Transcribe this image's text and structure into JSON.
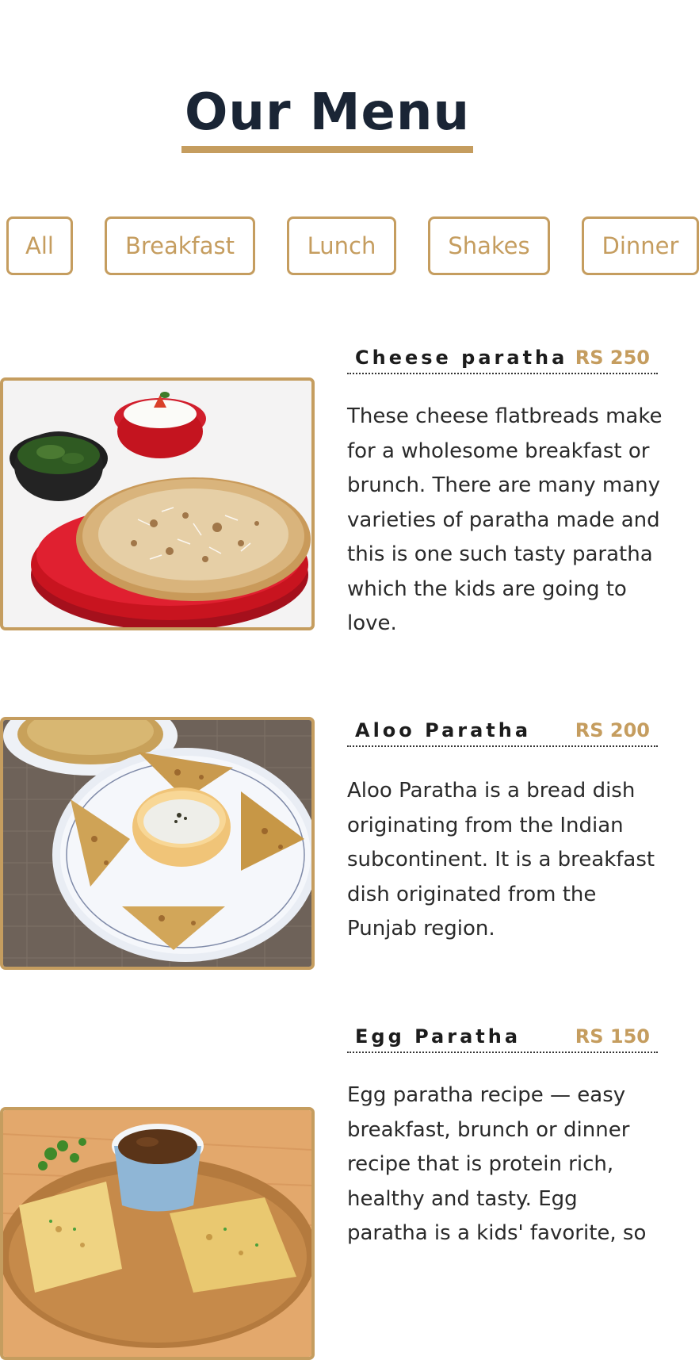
{
  "page": {
    "title": "Our Menu"
  },
  "filters": [
    {
      "label": "All"
    },
    {
      "label": "Breakfast"
    },
    {
      "label": "Lunch"
    },
    {
      "label": "Shakes"
    },
    {
      "label": "Dinner"
    }
  ],
  "menu_items": [
    {
      "name": "Cheese paratha",
      "price": "RS 250",
      "description": "These cheese flatbreads make for a wholesome breakfast or brunch. There are many many varieties of paratha made and this is one such tasty paratha which the kids are going to love."
    },
    {
      "name": "Aloo Paratha",
      "price": "RS 200",
      "description": "Aloo Paratha is a bread dish originating from the Indian subcontinent. It is a breakfast dish originated from the Punjab region."
    },
    {
      "name": "Egg Paratha",
      "price": "RS 150",
      "description": "Egg paratha recipe — easy breakfast, brunch or dinner recipe that is protein rich, healthy and tasty. Egg paratha is a kids' favorite, so"
    }
  ],
  "colors": {
    "accent": "#c59d5f",
    "heading": "#1a2535",
    "text": "#2a2a2a"
  }
}
